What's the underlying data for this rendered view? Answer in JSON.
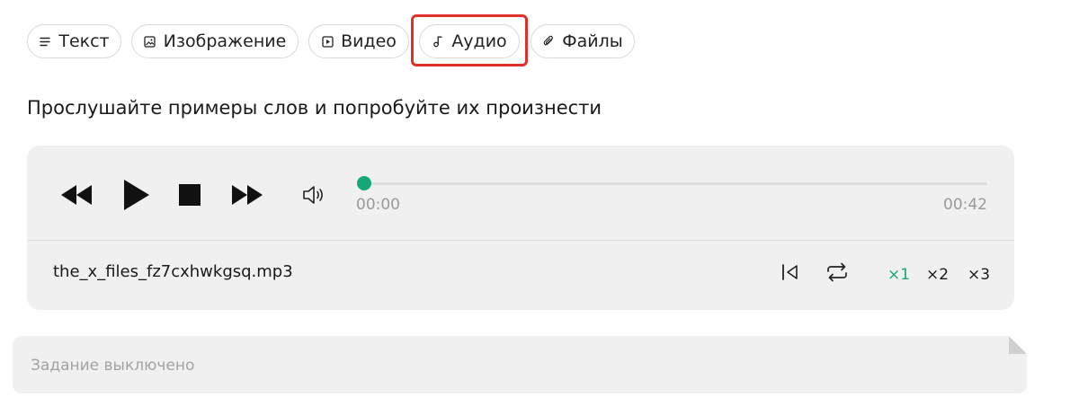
{
  "tabs": [
    {
      "label": "Текст",
      "icon": "lines-icon"
    },
    {
      "label": "Изображение",
      "icon": "image-icon"
    },
    {
      "label": "Видео",
      "icon": "video-icon"
    },
    {
      "label": "Аудио",
      "icon": "music-note-icon",
      "selected": true
    },
    {
      "label": "Файлы",
      "icon": "paperclip-icon"
    }
  ],
  "instruction": "Прослушайте примеры слов и попробуйте их произнести",
  "player": {
    "current_time": "00:00",
    "duration": "00:42",
    "progress": 0,
    "filename": "the_x_files_fz7cxhwkgsq.mp3",
    "speeds": [
      "×1",
      "×2",
      "×3"
    ],
    "active_speed": "×1",
    "accent_color": "#16a67a"
  },
  "task": {
    "placeholder": "Задание выключено"
  },
  "colors": {
    "highlight": "#e0302a",
    "panel": "#f0f0f0"
  }
}
